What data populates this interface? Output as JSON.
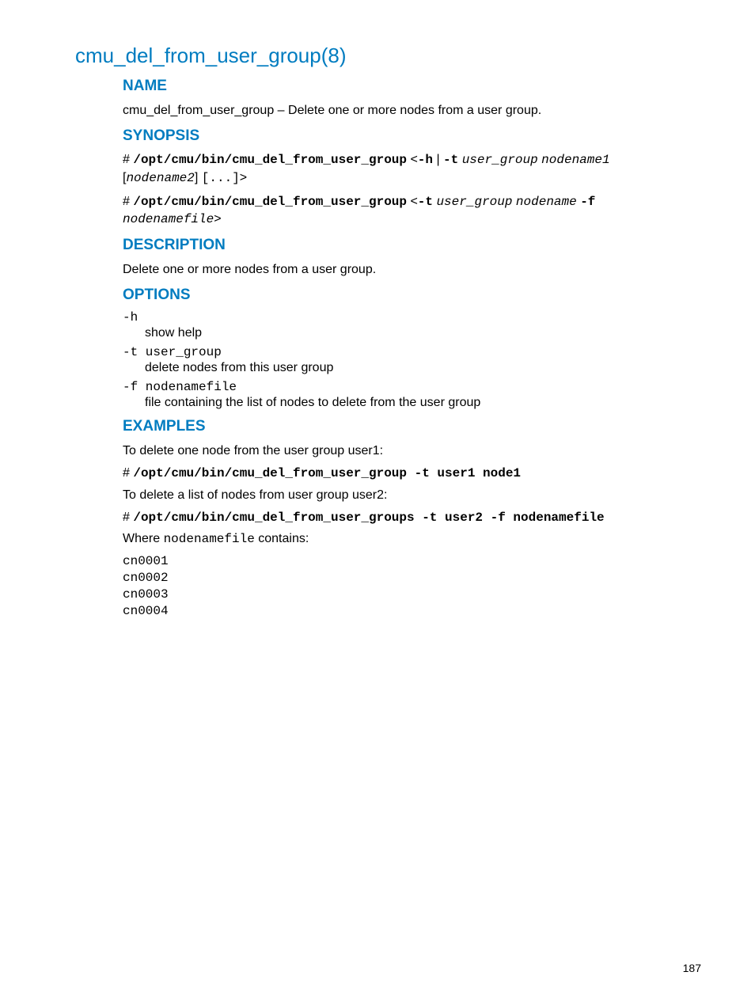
{
  "page": {
    "title": "cmu_del_from_user_group(8)",
    "number": "187"
  },
  "sections": {
    "name": {
      "heading": "NAME",
      "text": "cmu_del_from_user_group – Delete one or more nodes from a user group."
    },
    "synopsis": {
      "heading": "SYNOPSIS",
      "line1": {
        "hash": "# ",
        "cmd": "/opt/cmu/bin/cmu_del_from_user_group",
        "angle_open": " <",
        "opt_h": "-h",
        "pipe": " | ",
        "opt_t": "-t",
        "space1": " ",
        "arg1": "user_group",
        "space2": " ",
        "arg2": "nodename1",
        "bracket_open": " [",
        "arg3": "nodename2",
        "bracket_close": "]",
        "space3": " ",
        "ellipsis": "[...]",
        "angle_close": ">"
      },
      "line2": {
        "hash": "# ",
        "cmd": "/opt/cmu/bin/cmu_del_from_user_group",
        "angle_open": " <",
        "opt_t": "-t",
        "space1": " ",
        "arg1": "user_group",
        "space2": " ",
        "arg2": "nodename",
        "space3": " ",
        "opt_f": "-f",
        "space4": " ",
        "arg3": "nodenamefile",
        "angle_close": ">"
      }
    },
    "description": {
      "heading": "DESCRIPTION",
      "text": "Delete one or more nodes from a user group."
    },
    "options": {
      "heading": "OPTIONS",
      "opt1": {
        "term": "-h",
        "desc": "show help"
      },
      "opt2": {
        "term": "-t user_group",
        "desc": "delete nodes from this user group"
      },
      "opt3": {
        "term": "-f nodenamefile",
        "desc": "file containing the list of nodes to delete from the user group"
      }
    },
    "examples": {
      "heading": "EXAMPLES",
      "intro1": "To delete one node from the user group user1:",
      "cmd1": {
        "hash": "# ",
        "cmd": "/opt/cmu/bin/cmu_del_from_user_group -t user1 node1"
      },
      "intro2": "To delete a list of nodes from user group user2:",
      "cmd2": {
        "hash": "# ",
        "cmd": "/opt/cmu/bin/cmu_del_from_user_groups -t user2 -f nodenamefile"
      },
      "where_prefix": "Where ",
      "where_code": "nodenamefile",
      "where_suffix": " contains:",
      "codeblock": "cn0001\ncn0002\ncn0003\ncn0004"
    }
  }
}
